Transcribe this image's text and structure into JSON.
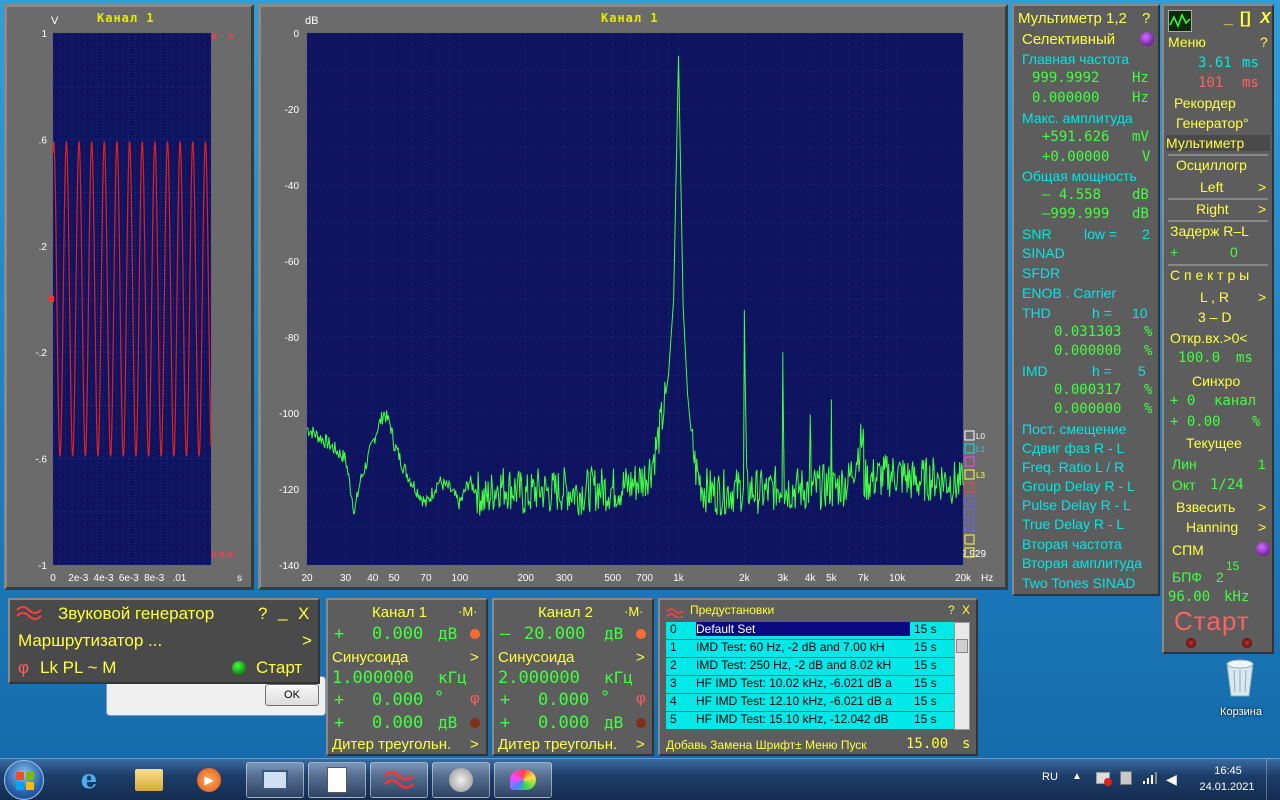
{
  "scope": {
    "title": "Канал 1",
    "unit": "V",
    "y_ticks": [
      "1",
      ".6",
      ".2",
      "-.2",
      "-.6",
      "-1"
    ],
    "x_ticks": [
      "0",
      "2e-3",
      "4e-3",
      "6e-3",
      "8e-3",
      ".01"
    ],
    "x_unit": "s",
    "marker_top": "a ~ a",
    "marker_bottom": "a a a"
  },
  "spectrum": {
    "title": "Канал 1",
    "unit": "dB",
    "x_unit": "Hz",
    "side_value": "2.929",
    "legend_labels": [
      "L0",
      "L1",
      "",
      "L3",
      "",
      "",
      "",
      "",
      "",
      ""
    ]
  },
  "chart_data": [
    {
      "type": "line",
      "title": "Канал 1",
      "ylabel": "V",
      "xlabel": "s",
      "xlim": [
        0,
        0.0125
      ],
      "ylim": [
        -1,
        1
      ],
      "grid": true,
      "series": [
        {
          "name": "",
          "frequency_hz": 1000,
          "amplitude": 0.59
        }
      ],
      "x_ticks": [
        0,
        0.002,
        0.004,
        0.006,
        0.008,
        0.01
      ],
      "y_ticks": [
        1,
        0.6,
        0.2,
        -0.2,
        -0.6,
        -1
      ]
    },
    {
      "type": "line",
      "title": "Канал 1",
      "ylabel": "dB",
      "xlabel": "Hz",
      "x_scale": "log",
      "xlim": [
        20,
        20000
      ],
      "ylim": [
        -140,
        0
      ],
      "grid": true,
      "y_ticks": [
        0,
        -20,
        -40,
        -60,
        -80,
        -100,
        -120,
        -140
      ],
      "x_ticks": [
        "20",
        "30",
        "40",
        "50",
        "70",
        "100",
        "200",
        "300",
        "500",
        "700",
        "1k",
        "2k",
        "3k",
        "4k",
        "5k",
        "7k",
        "10k",
        "20k"
      ],
      "x_tick_values": [
        20,
        30,
        40,
        50,
        70,
        100,
        200,
        300,
        500,
        700,
        1000,
        2000,
        3000,
        4000,
        5000,
        7000,
        10000,
        20000
      ],
      "series": [
        {
          "name": "",
          "points": [
            [
              20,
              -104
            ],
            [
              25,
              -108
            ],
            [
              30,
              -112
            ],
            [
              33,
              -126
            ],
            [
              35,
              -118
            ],
            [
              38,
              -112
            ],
            [
              42,
              -104
            ],
            [
              45,
              -100
            ],
            [
              48,
              -103
            ],
            [
              50,
              -108
            ],
            [
              55,
              -114
            ],
            [
              60,
              -118
            ],
            [
              70,
              -124
            ],
            [
              80,
              -118
            ],
            [
              90,
              -120
            ],
            [
              100,
              -124
            ],
            [
              110,
              -118
            ],
            [
              130,
              -123
            ],
            [
              150,
              -119
            ],
            [
              180,
              -120
            ],
            [
              200,
              -122
            ],
            [
              230,
              -120
            ],
            [
              260,
              -121
            ],
            [
              300,
              -120
            ],
            [
              350,
              -121
            ],
            [
              400,
              -120
            ],
            [
              500,
              -120
            ],
            [
              600,
              -119
            ],
            [
              700,
              -117
            ],
            [
              750,
              -114
            ],
            [
              800,
              -108
            ],
            [
              850,
              -100
            ],
            [
              900,
              -90
            ],
            [
              950,
              -70
            ],
            [
              1000,
              -6
            ],
            [
              1050,
              -72
            ],
            [
              1100,
              -95
            ],
            [
              1150,
              -107
            ],
            [
              1200,
              -115
            ],
            [
              1300,
              -120
            ],
            [
              1500,
              -121
            ],
            [
              2000,
              -120
            ],
            [
              2000,
              -76
            ],
            [
              2050,
              -120
            ],
            [
              2500,
              -121
            ],
            [
              3000,
              -119
            ],
            [
              3000,
              -84
            ],
            [
              3050,
              -120
            ],
            [
              4000,
              -120
            ],
            [
              4000,
              -103
            ],
            [
              4050,
              -120
            ],
            [
              5000,
              -119
            ],
            [
              5000,
              -100
            ],
            [
              5050,
              -120
            ],
            [
              6000,
              -118
            ],
            [
              7000,
              -106
            ],
            [
              7050,
              -118
            ],
            [
              8000,
              -117
            ],
            [
              10000,
              -116
            ],
            [
              12000,
              -118
            ],
            [
              15000,
              -117
            ],
            [
              20000,
              -119
            ]
          ]
        }
      ]
    }
  ],
  "multimeter": {
    "title": "Мультиметр 1,2",
    "help": "?",
    "selective": "Селективный",
    "main_freq_label": "Главная частота",
    "freq1": "999.9992",
    "freq1_unit": "Hz",
    "freq2": "0.000000",
    "freq2_unit": "Hz",
    "max_amp_label": "Макс. амплитуда",
    "amp1": "+591.626",
    "amp1_unit": "mV",
    "amp2": "+0.00000",
    "amp2_unit": "V",
    "power_label": "Общая мощность",
    "pow1": "–  4.558",
    "pow1_unit": "dB",
    "pow2": "–999.999",
    "pow2_unit": "dB",
    "snr": "SNR",
    "snr_low": "low =",
    "snr_low_val": "2",
    "sinad": "SINAD",
    "sfdr": "SFDR",
    "enob": "ENOB . Carrier",
    "thd": "THD",
    "thd_h": "h =",
    "thd_h_val": "10",
    "thd1": "0.031303",
    "thd2": "0.000000",
    "pct": "%",
    "imd": "IMD",
    "imd_h": "h =",
    "imd_h_val": "5",
    "imd1": "0.000317",
    "imd2": "0.000000",
    "dc_offset": "Пост. смещение",
    "phase_shift": "Сдвиг фаз R - L",
    "freq_ratio": "Freq. Ratio  L / R",
    "group_delay": "Group Delay R - L",
    "pulse_delay": "Pulse Delay R - L",
    "true_delay": "True Delay R - L",
    "second_freq": "Вторая частота",
    "second_amp": "Вторая амплитуда",
    "two_tones": "Two Tones SINAD"
  },
  "right_panel": {
    "minimize": "_",
    "maximize": "[]",
    "close": "X",
    "menu": "Меню",
    "help": "?",
    "ms1": "3.61",
    "ms1_unit": "ms",
    "ms2": "101",
    "ms2_unit": "ms",
    "recorder": "Рекордер",
    "generator": "Генератор°",
    "multimeter": "Мультиметр",
    "oscillograph": "Осциллогр",
    "left": "Left",
    "right": "Right",
    "arrow": ">",
    "delay": "Задерж  R–L",
    "delay_sign": "+",
    "delay_val": "0",
    "spectra": "С п е к т р ы",
    "lr": "L , R",
    "d3": "3 – D",
    "open_in": "Откр.вх.>0<",
    "open_ms": "100.0",
    "open_ms_unit": "ms",
    "sync": "Синхро",
    "sync_ch": "+  0",
    "sync_ch_label": "канал",
    "sync_pct": "+ 0.00",
    "sync_pct_unit": "%",
    "current": "Текущее",
    "lin": "Лин",
    "lin_val": "1",
    "oct": "Окт",
    "oct_val": "1/24",
    "weigh": "Взвесить",
    "window": "Hanning",
    "spm": "СПМ",
    "fft": "БПФ",
    "fft_base": "2",
    "fft_exp": "15",
    "rate": "96.00",
    "rate_unit": "kHz",
    "start": "Старт"
  },
  "generator": {
    "title": "Звуковой генератор",
    "help": "?",
    "minimize": "_",
    "close": "X",
    "router": "Маршрутизатор ...",
    "router_arrow": ">",
    "phi": "φ",
    "modes": "Lk PL ~ M",
    "start": "Старт"
  },
  "ch1": {
    "title": "Канал 1",
    "m": "·M·",
    "level_sign": "+",
    "level": "0.000",
    "level_unit": "дВ",
    "wave": "Синусоида",
    "freq": "1.000000",
    "freq_unit": "кГц",
    "phase_sign": "+",
    "phase": "0.000",
    "phase_unit": "°",
    "phi": "φ",
    "offs_sign": "+",
    "offs": "0.000",
    "offs_unit": "дВ",
    "dither": "Дитер треугольн.",
    "arrow": ">"
  },
  "ch2": {
    "title": "Канал 2",
    "m": "·M·",
    "level_sign": "–",
    "level": "20.000",
    "level_unit": "дВ",
    "wave": "Синусоида",
    "freq": "2.000000",
    "freq_unit": "кГц",
    "phase_sign": "+",
    "phase": "0.000",
    "phase_unit": "°",
    "phi": "φ",
    "offs_sign": "+",
    "offs": "0.000",
    "offs_unit": "дВ",
    "dither": "Дитер треугольн.",
    "arrow": ">"
  },
  "presets": {
    "title": "Предустановки",
    "help": "?",
    "close": "X",
    "items": [
      {
        "n": "0",
        "text": "Default Set",
        "dur": "15 s"
      },
      {
        "n": "1",
        "text": "IMD Test: 60 Hz,  -2 dB and 7.00 kH",
        "dur": "15 s"
      },
      {
        "n": "2",
        "text": "IMD Test: 250 Hz, -2 dB and 8.02 kH",
        "dur": "15 s"
      },
      {
        "n": "3",
        "text": "HF IMD Test: 10.02 kHz, -6.021 dB a",
        "dur": "15 s"
      },
      {
        "n": "4",
        "text": "HF IMD Test: 12.10 kHz, -6.021 dB a",
        "dur": "15 s"
      },
      {
        "n": "5",
        "text": "HF IMD Test: 15.10 kHz, -12.042 dB",
        "dur": "15 s"
      }
    ],
    "footer": "Добавь Замена Шрифт± Меню Пуск",
    "footer_val": "15.00",
    "footer_unit": "s"
  },
  "dialog": {
    "ok": "OK"
  },
  "desktop": {
    "recycle_bin": "Корзина"
  },
  "taskbar": {
    "lang": "RU",
    "time": "16:45",
    "date": "24.01.2021"
  },
  "colors": {
    "plot_bg": "#0f1460",
    "scope_trace": "#e02020",
    "spectrum_trace": "#40ff40",
    "panel": "#5d5d5d"
  }
}
